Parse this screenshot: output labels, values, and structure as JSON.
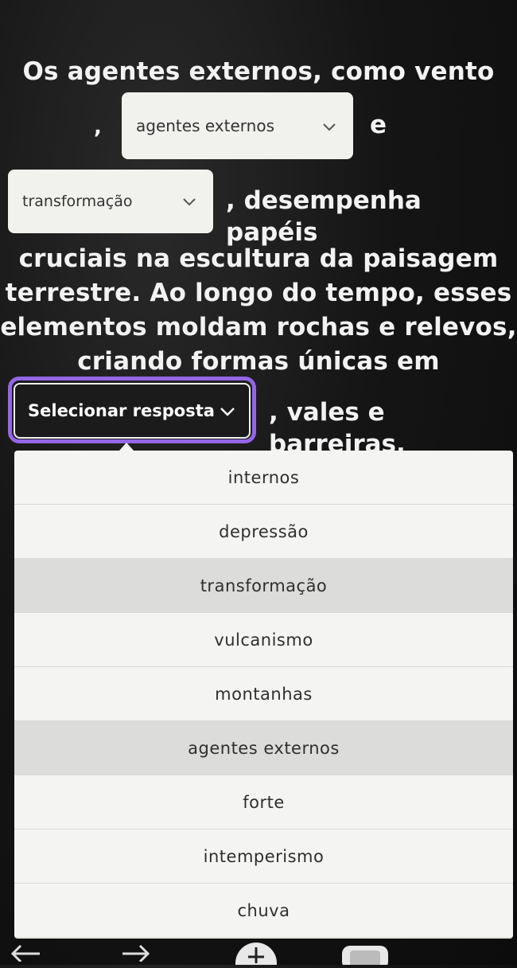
{
  "sentence": {
    "line1": "Os agentes externos, como vento",
    "comma1": ",",
    "e_word": "e",
    "after_dropdown2": ", desempenha papéis",
    "line3": "cruciais na escultura da paisagem",
    "line4": "terrestre. Ao longo do tempo, esses",
    "line5": "elementos moldam rochas e relevos,",
    "line6": "criando formas únicas em",
    "after_dropdown3": ", vales e barreiras."
  },
  "dropdowns": {
    "first_value": "agentes externos",
    "second_value": "transformação",
    "third_placeholder": "Selecionar resposta"
  },
  "menu": {
    "options": [
      "internos",
      "depressão",
      "transformação",
      "vulcanismo",
      "montanhas",
      "agentes externos",
      "forte",
      "intemperismo",
      "chuva"
    ]
  },
  "icons": {
    "chevron": "chevron-down-icon",
    "back": "arrow-left-icon",
    "forward": "arrow-right-icon",
    "add": "plus-icon"
  },
  "colors": {
    "accent": "#9466e6",
    "menu_bg": "#f4f4f2",
    "highlight": "#dcdcda"
  }
}
